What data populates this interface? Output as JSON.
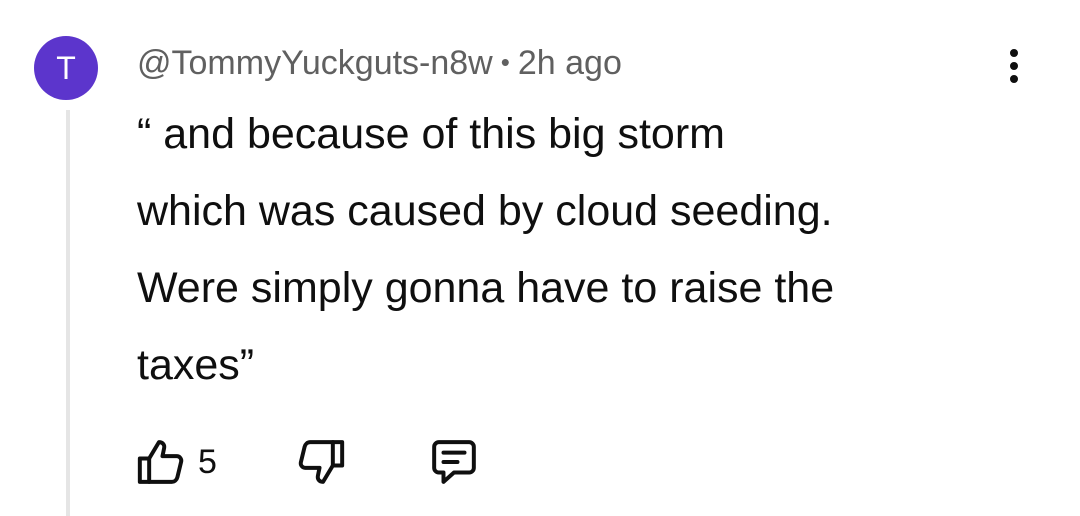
{
  "comment": {
    "avatar_initial": "T",
    "avatar_color": "#5c35cc",
    "author": "@TommyYuckguts-n8w",
    "separator": "•",
    "time": "2h ago",
    "text_lines": [
      "“ and because of this big storm",
      "which was caused by cloud seeding.",
      "Were simply gonna have to raise the",
      "taxes”"
    ],
    "like_count": "5"
  },
  "icons": {
    "like": "thumbs-up-icon",
    "dislike": "thumbs-down-icon",
    "reply": "reply-comment-icon",
    "menu": "more-vert-icon"
  }
}
